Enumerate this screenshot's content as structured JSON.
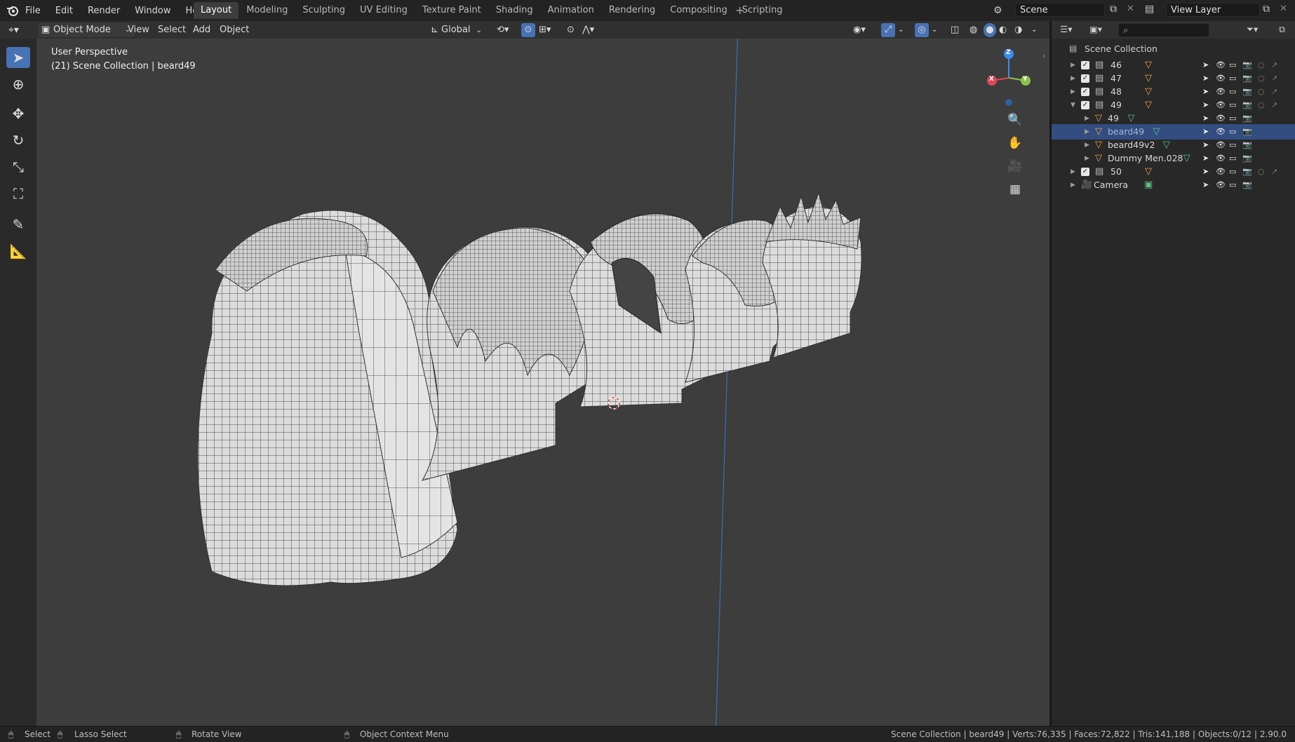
{
  "menu": [
    "File",
    "Edit",
    "Render",
    "Window",
    "Help"
  ],
  "workspace_tabs": [
    {
      "label": "Layout",
      "active": true
    },
    {
      "label": "Modeling",
      "active": false
    },
    {
      "label": "Sculpting",
      "active": false
    },
    {
      "label": "UV Editing",
      "active": false
    },
    {
      "label": "Texture Paint",
      "active": false
    },
    {
      "label": "Shading",
      "active": false
    },
    {
      "label": "Animation",
      "active": false
    },
    {
      "label": "Rendering",
      "active": false
    },
    {
      "label": "Compositing",
      "active": false
    },
    {
      "label": "Scripting",
      "active": false
    }
  ],
  "add_tab_symbol": "+",
  "scene_name": "Scene",
  "view_layer_name": "View Layer",
  "viewport_header": {
    "mode": "Object Mode",
    "menus": [
      "View",
      "Select",
      "Add",
      "Object"
    ],
    "orientation": "Global"
  },
  "viewport": {
    "perspective_label": "User Perspective",
    "collection_label": "(21) Scene Collection | beard49",
    "gizmo_axes": {
      "x": "X",
      "y": "Y",
      "z": "Z"
    }
  },
  "outliner": {
    "root": "Scene Collection",
    "rows": [
      {
        "label": "46",
        "kind": "collection",
        "indent": 0,
        "selected": false
      },
      {
        "label": "47",
        "kind": "collection",
        "indent": 0,
        "selected": false
      },
      {
        "label": "48",
        "kind": "collection",
        "indent": 0,
        "selected": false
      },
      {
        "label": "49",
        "kind": "collection",
        "indent": 0,
        "selected": false
      },
      {
        "label": "49",
        "kind": "mesh",
        "indent": 1,
        "selected": false
      },
      {
        "label": "beard49",
        "kind": "mesh",
        "indent": 1,
        "selected": true
      },
      {
        "label": "beard49v2",
        "kind": "mesh",
        "indent": 1,
        "selected": false
      },
      {
        "label": "Dummy Men.028",
        "kind": "mesh",
        "indent": 1,
        "selected": false
      },
      {
        "label": "50",
        "kind": "collection",
        "indent": 0,
        "selected": false
      },
      {
        "label": "Camera",
        "kind": "camera",
        "indent": 0,
        "selected": false
      }
    ]
  },
  "status_bar": {
    "select": "Select",
    "lasso": "Lasso Select",
    "rotate": "Rotate View",
    "context": "Object Context Menu",
    "stats": "Scene Collection | beard49 | Verts:76,335 | Faces:72,822 | Tris:141,188 | Objects:0/12 | 2.90.0"
  },
  "colors": {
    "accent": "#4772b3",
    "selected_row": "#334d80",
    "mesh_orange": "#e8a050",
    "mesh_green": "#5fbf8a",
    "axis_x": "#e2445c",
    "axis_y": "#8bc34a",
    "axis_z": "#3a8cf0"
  }
}
